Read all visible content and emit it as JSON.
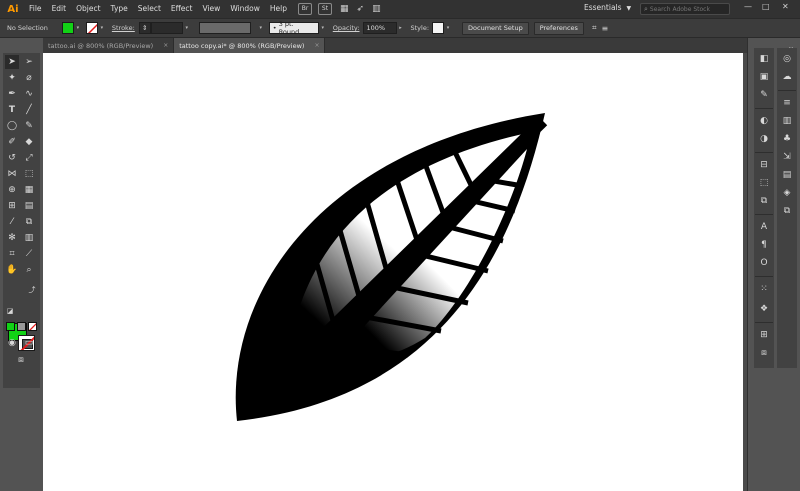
{
  "menubar": {
    "logo": "Ai",
    "items": [
      "File",
      "Edit",
      "Object",
      "Type",
      "Select",
      "Effect",
      "View",
      "Window",
      "Help"
    ],
    "app_icons": [
      "Br",
      "St"
    ],
    "workspace": "Essentials",
    "search_placeholder": "Search Adobe Stock",
    "window_controls": [
      "—",
      "□",
      "✕"
    ]
  },
  "controlbar": {
    "selection_label": "No Selection",
    "fill_color": "#12d216",
    "stroke_label": "Stroke:",
    "brush_value": "3 pt. Round",
    "opacity_label": "Opacity:",
    "opacity_value": "100%",
    "style_label": "Style:",
    "document_setup": "Document Setup",
    "preferences": "Preferences"
  },
  "tabs": [
    {
      "label": "tattoo.ai @ 800% (RGB/Preview)",
      "close": "×",
      "active": false
    },
    {
      "label": "tattoo copy.ai* @ 800% (RGB/Preview)",
      "close": "×",
      "active": true
    }
  ],
  "toolbar": {
    "fill_color": "#12d216",
    "stroke_color": "#ffffff"
  },
  "colors": {
    "ui_dark": "#323232",
    "ui_panel": "#535353",
    "artboard": "#ffffff",
    "leaf": "#000000"
  }
}
